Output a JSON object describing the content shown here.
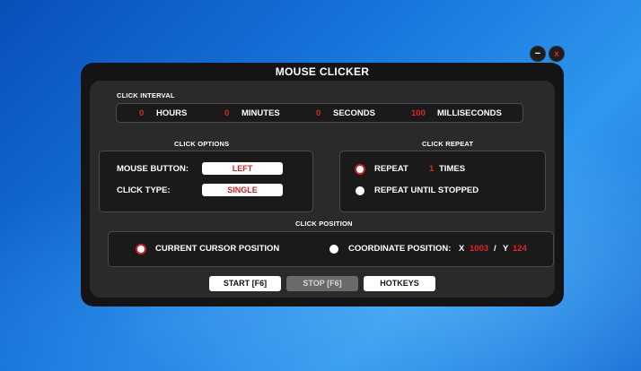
{
  "window": {
    "title": "MOUSE CLICKER",
    "minimize_label": "−",
    "close_label": "x"
  },
  "interval": {
    "label": "CLICK INTERVAL",
    "hours": {
      "value": "0",
      "unit": "HOURS"
    },
    "minutes": {
      "value": "0",
      "unit": "MINUTES"
    },
    "seconds": {
      "value": "0",
      "unit": "SECONDS"
    },
    "milliseconds": {
      "value": "100",
      "unit": "MILLISECONDS"
    }
  },
  "options": {
    "label": "CLICK OPTIONS",
    "mouse_button_label": "MOUSE BUTTON:",
    "mouse_button_value": "LEFT",
    "click_type_label": "CLICK TYPE:",
    "click_type_value": "SINGLE"
  },
  "repeat": {
    "label": "CLICK REPEAT",
    "repeat_label": "REPEAT",
    "repeat_count": "1",
    "times_label": "TIMES",
    "until_stopped_label": "REPEAT UNTIL STOPPED"
  },
  "position": {
    "label": "CLICK POSITION",
    "current_label": "CURRENT CURSOR POSITION",
    "coordinate_label": "COORDINATE POSITION:",
    "x_label": "X",
    "x_value": "1003",
    "separator": "/",
    "y_label": "Y",
    "y_value": "124"
  },
  "actions": {
    "start_label": "START [F6]",
    "stop_label": "STOP [F6]",
    "hotkeys_label": "HOTKEYS"
  }
}
